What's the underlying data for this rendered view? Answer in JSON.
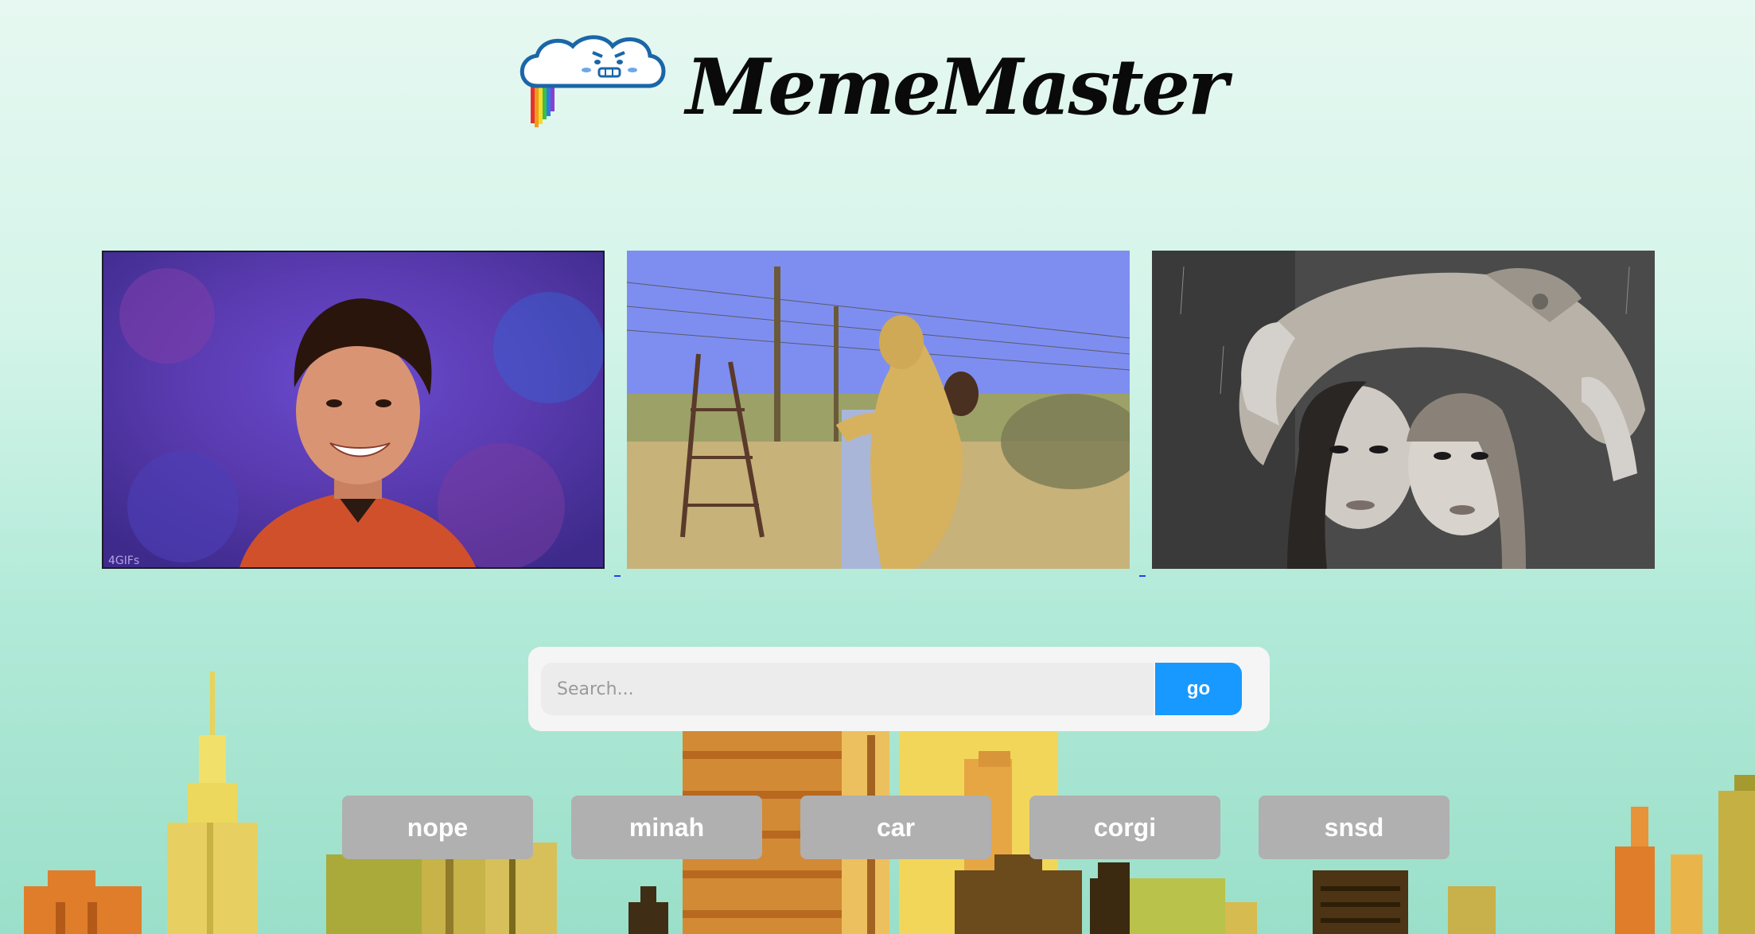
{
  "header": {
    "brand_name": "MemeMaster",
    "logo_icon": "rainbow-cloud-icon"
  },
  "gifs": [
    {
      "name": "gif-smiling-man"
    },
    {
      "name": "gif-lion-hug"
    },
    {
      "name": "gif-women-under-coat"
    }
  ],
  "search": {
    "placeholder": "Search...",
    "go_label": "go"
  },
  "tags": [
    "nope",
    "minah",
    "car",
    "corgi",
    "snsd"
  ],
  "colors": {
    "accent": "#1899ff",
    "tag_bg": "#b0b0b0",
    "background": "#d4f4e9"
  }
}
